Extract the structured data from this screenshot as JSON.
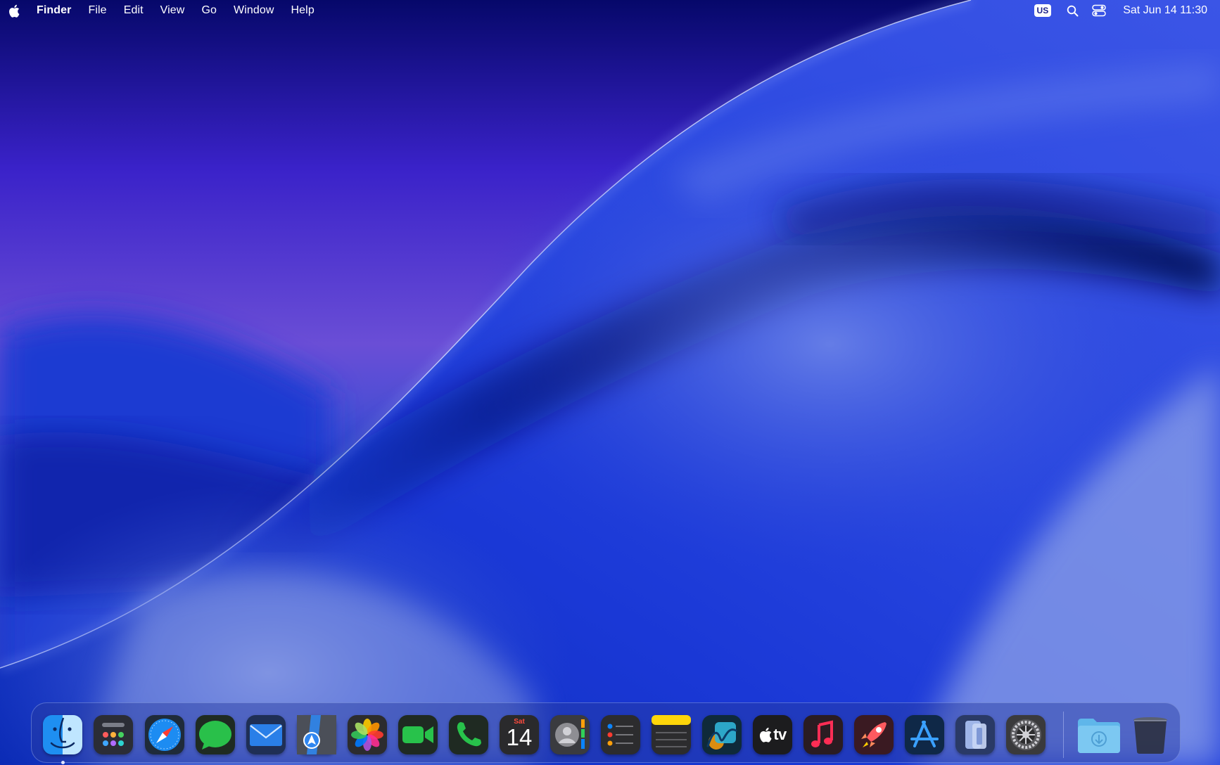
{
  "menubar": {
    "app_name": "Finder",
    "menus": [
      "File",
      "Edit",
      "View",
      "Go",
      "Window",
      "Help"
    ],
    "input_source": "US",
    "datetime": "Sat Jun 14  11:30"
  },
  "dock": {
    "calendar": {
      "weekday": "Sat",
      "day": "14"
    },
    "tv_label": "tv",
    "apps": [
      "finder-icon",
      "launchpad-icon",
      "safari-icon",
      "messages-icon",
      "mail-icon",
      "maps-icon",
      "photos-icon",
      "facetime-icon",
      "phone-icon",
      "calendar-icon",
      "contacts-icon",
      "reminders-icon",
      "notes-icon",
      "freeform-icon",
      "apple-tv-icon",
      "music-icon",
      "rocket-icon",
      "app-store-icon",
      "iphone-mirroring-icon",
      "system-settings-icon",
      "downloads-folder-icon",
      "trash-icon"
    ]
  },
  "colors": {
    "sky_top": "#07086b",
    "sky_mid": "#5a3bd6",
    "wave_blue": "#1b2fd0",
    "dock_bg": "#2a3ca0"
  }
}
